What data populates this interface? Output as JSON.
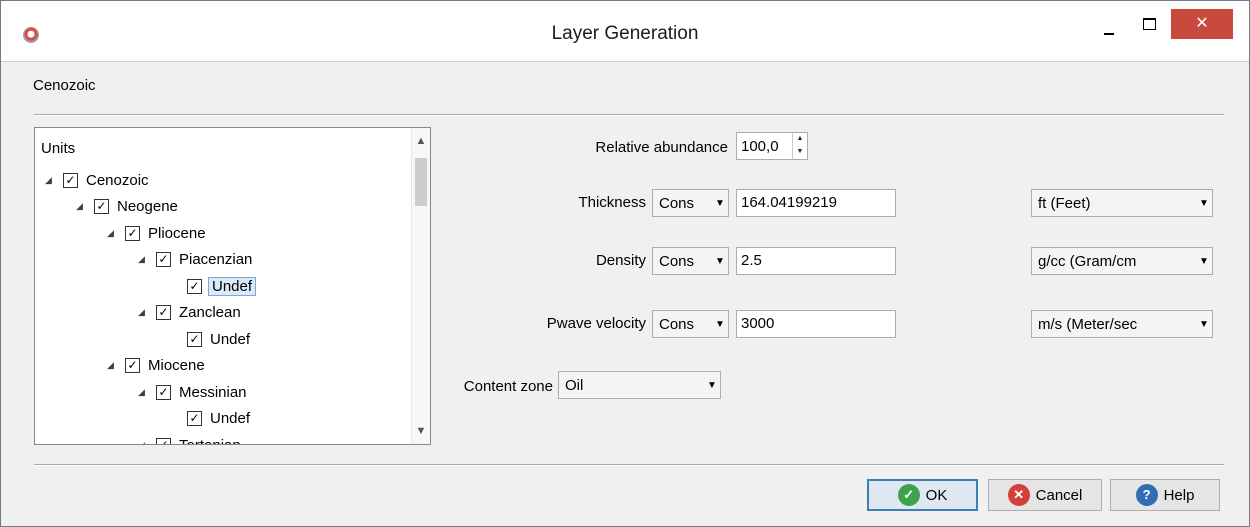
{
  "window": {
    "title": "Layer Generation",
    "close_glyph": "✕"
  },
  "header": {
    "label": "Cenozoic"
  },
  "tree": {
    "header": "Units",
    "nodes": [
      {
        "label": "Cenozoic",
        "level": 0,
        "checked": true,
        "expanded": true
      },
      {
        "label": "Neogene",
        "level": 1,
        "checked": true,
        "expanded": true
      },
      {
        "label": "Pliocene",
        "level": 2,
        "checked": true,
        "expanded": true
      },
      {
        "label": "Piacenzian",
        "level": 3,
        "checked": true,
        "expanded": true
      },
      {
        "label": "Undef",
        "level": 4,
        "checked": true,
        "leaf": true,
        "selected": true
      },
      {
        "label": "Zanclean",
        "level": 3,
        "checked": true,
        "expanded": true
      },
      {
        "label": "Undef",
        "level": 4,
        "checked": true,
        "leaf": true
      },
      {
        "label": "Miocene",
        "level": 2,
        "checked": true,
        "expanded": true
      },
      {
        "label": "Messinian",
        "level": 3,
        "checked": true,
        "expanded": true
      },
      {
        "label": "Undef",
        "level": 4,
        "checked": true,
        "leaf": true
      },
      {
        "label": "Tortonian",
        "level": 3,
        "checked": true,
        "expanded": true
      }
    ]
  },
  "form": {
    "relative_abundance": {
      "label": "Relative abundance",
      "value": "100,0"
    },
    "thickness": {
      "label": "Thickness",
      "mode": "Cons",
      "value": "164.04199219",
      "unit": "ft (Feet)"
    },
    "density": {
      "label": "Density",
      "mode": "Cons",
      "value": "2.5",
      "unit": "g/cc (Gram/cm"
    },
    "pwave": {
      "label": "Pwave velocity",
      "mode": "Cons",
      "value": "3000",
      "unit": "m/s (Meter/sec"
    },
    "content_zone": {
      "label": "Content zone",
      "value": "Oil"
    }
  },
  "buttons": {
    "ok": "OK",
    "cancel": "Cancel",
    "help": "Help"
  },
  "colors": {
    "ok": "#3fa34d",
    "cancel": "#d43f3a",
    "help": "#2f6db5",
    "close": "#c84a3e"
  }
}
